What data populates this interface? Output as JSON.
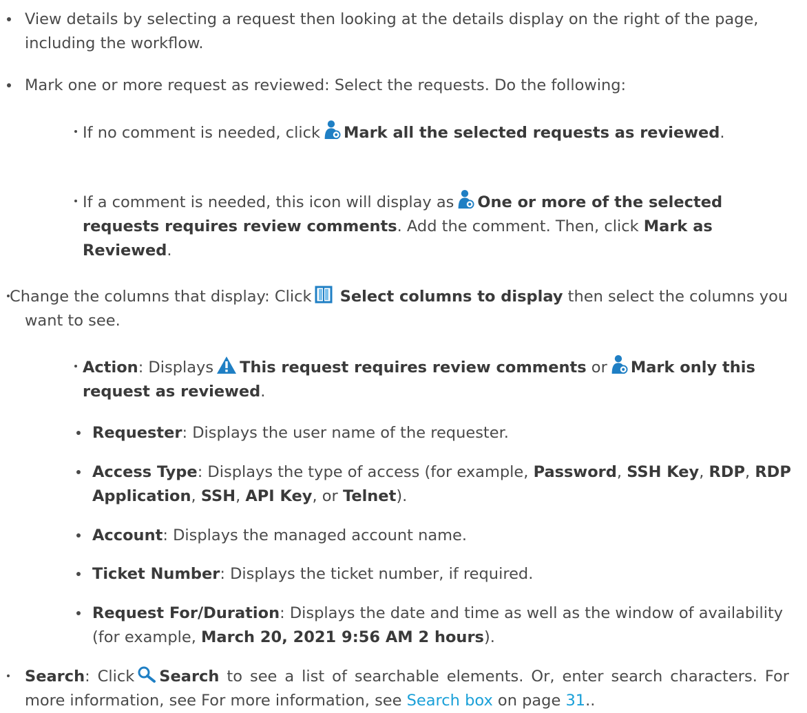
{
  "b1": {
    "text": "View details by selecting a request then looking at the details display on the right of the page, including the workflow."
  },
  "b2": {
    "text": "Mark one or more request as reviewed: Select the requests. Do the following:"
  },
  "b2a": {
    "pre": "If no comment is needed, click",
    "bold": "Mark all the selected requests as reviewed",
    "post": "."
  },
  "b2b": {
    "pre": "If a comment is needed, this icon will display as",
    "bold1": "One or more of the selected requests requires review comments",
    "mid": ". Add the comment. Then, click",
    "bold2": "Mark as Reviewed",
    "post": "."
  },
  "b3": {
    "pre": "Change the columns that display: Click",
    "bold": "Select columns to display",
    "post": "then select the columns you want to see."
  },
  "columns": {
    "action": {
      "label": "Action",
      "pre": ": Displays",
      "bold1": "This request requires review comments",
      "mid": "or",
      "bold2": "Mark only this request as reviewed",
      "post": "."
    },
    "requester": {
      "label": "Requester",
      "text": ": Displays the user name of the requester."
    },
    "access": {
      "label": "Access Type",
      "pre": ": Displays the type of access (for example,",
      "t1": "Password",
      "t2": "SSH Key",
      "t3": "RDP",
      "t4": "RDP Application",
      "t5": "SSH",
      "t6": "API Key",
      "or": "or",
      "t7": "Telnet",
      "post": ")."
    },
    "account": {
      "label": "Account",
      "text": ": Displays the managed account name."
    },
    "ticket": {
      "label": "Ticket Number",
      "text": ": Displays the ticket number, if required."
    },
    "request_for": {
      "label": "Request For/Duration",
      "pre": ": Displays the date and time as well as the window of availability (for example,",
      "example": "March 20, 2021 9:56 AM 2 hours",
      "post": ")."
    }
  },
  "b4": {
    "label": "Search",
    "pre": ": Click",
    "bold": "Search",
    "mid": "to see a list of searchable elements. Or, enter search characters. For more information, see For more information, see",
    "link": "Search box",
    "on_page": "on page",
    "page": "31",
    "post": ".."
  },
  "colors": {
    "text": "#4a4a4a",
    "link": "#1aa0d8",
    "icon_blue": "#1f7fc4",
    "warning": "#1f7fc4"
  },
  "icons": [
    "review-user-icon",
    "columns-icon",
    "warning-icon",
    "search-icon"
  ]
}
